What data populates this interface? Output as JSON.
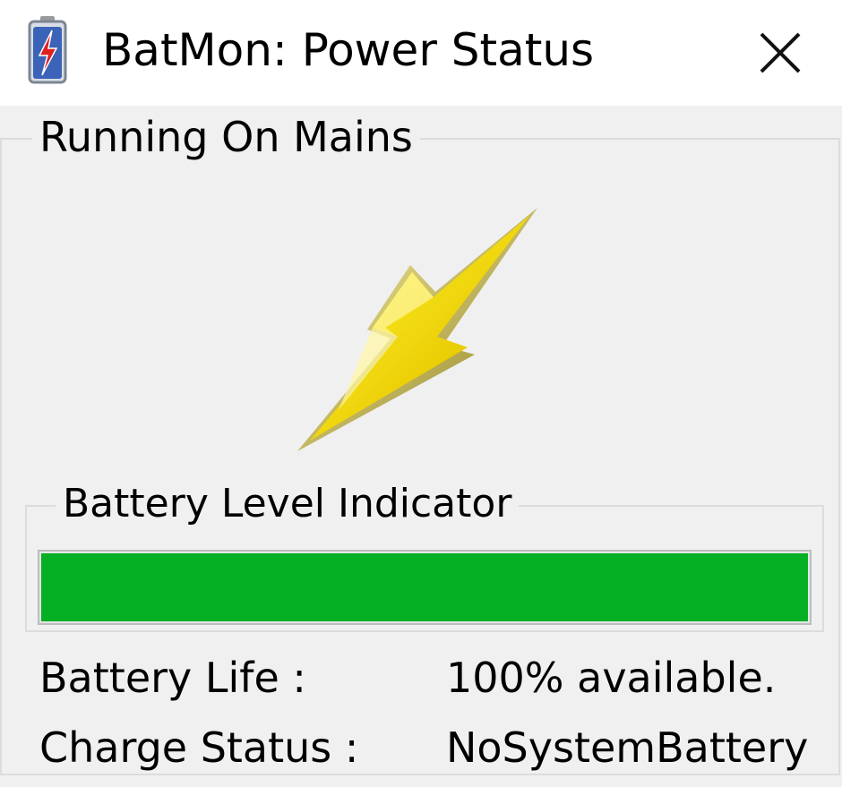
{
  "window": {
    "title": "BatMon: Power Status",
    "close_icon": "close-icon",
    "app_icon": "battery-icon"
  },
  "status_group": {
    "legend": "Running On Mains",
    "icon": "lightning-bolt-icon",
    "icon_color": "#f2d90c"
  },
  "battery_indicator": {
    "legend": "Battery Level Indicator",
    "level_percent": 100,
    "fill_color": "#06b025"
  },
  "info": {
    "battery_life_label": "Battery Life :",
    "battery_life_value": "100% available.",
    "charge_status_label": "Charge Status :",
    "charge_status_value": "NoSystemBattery"
  }
}
